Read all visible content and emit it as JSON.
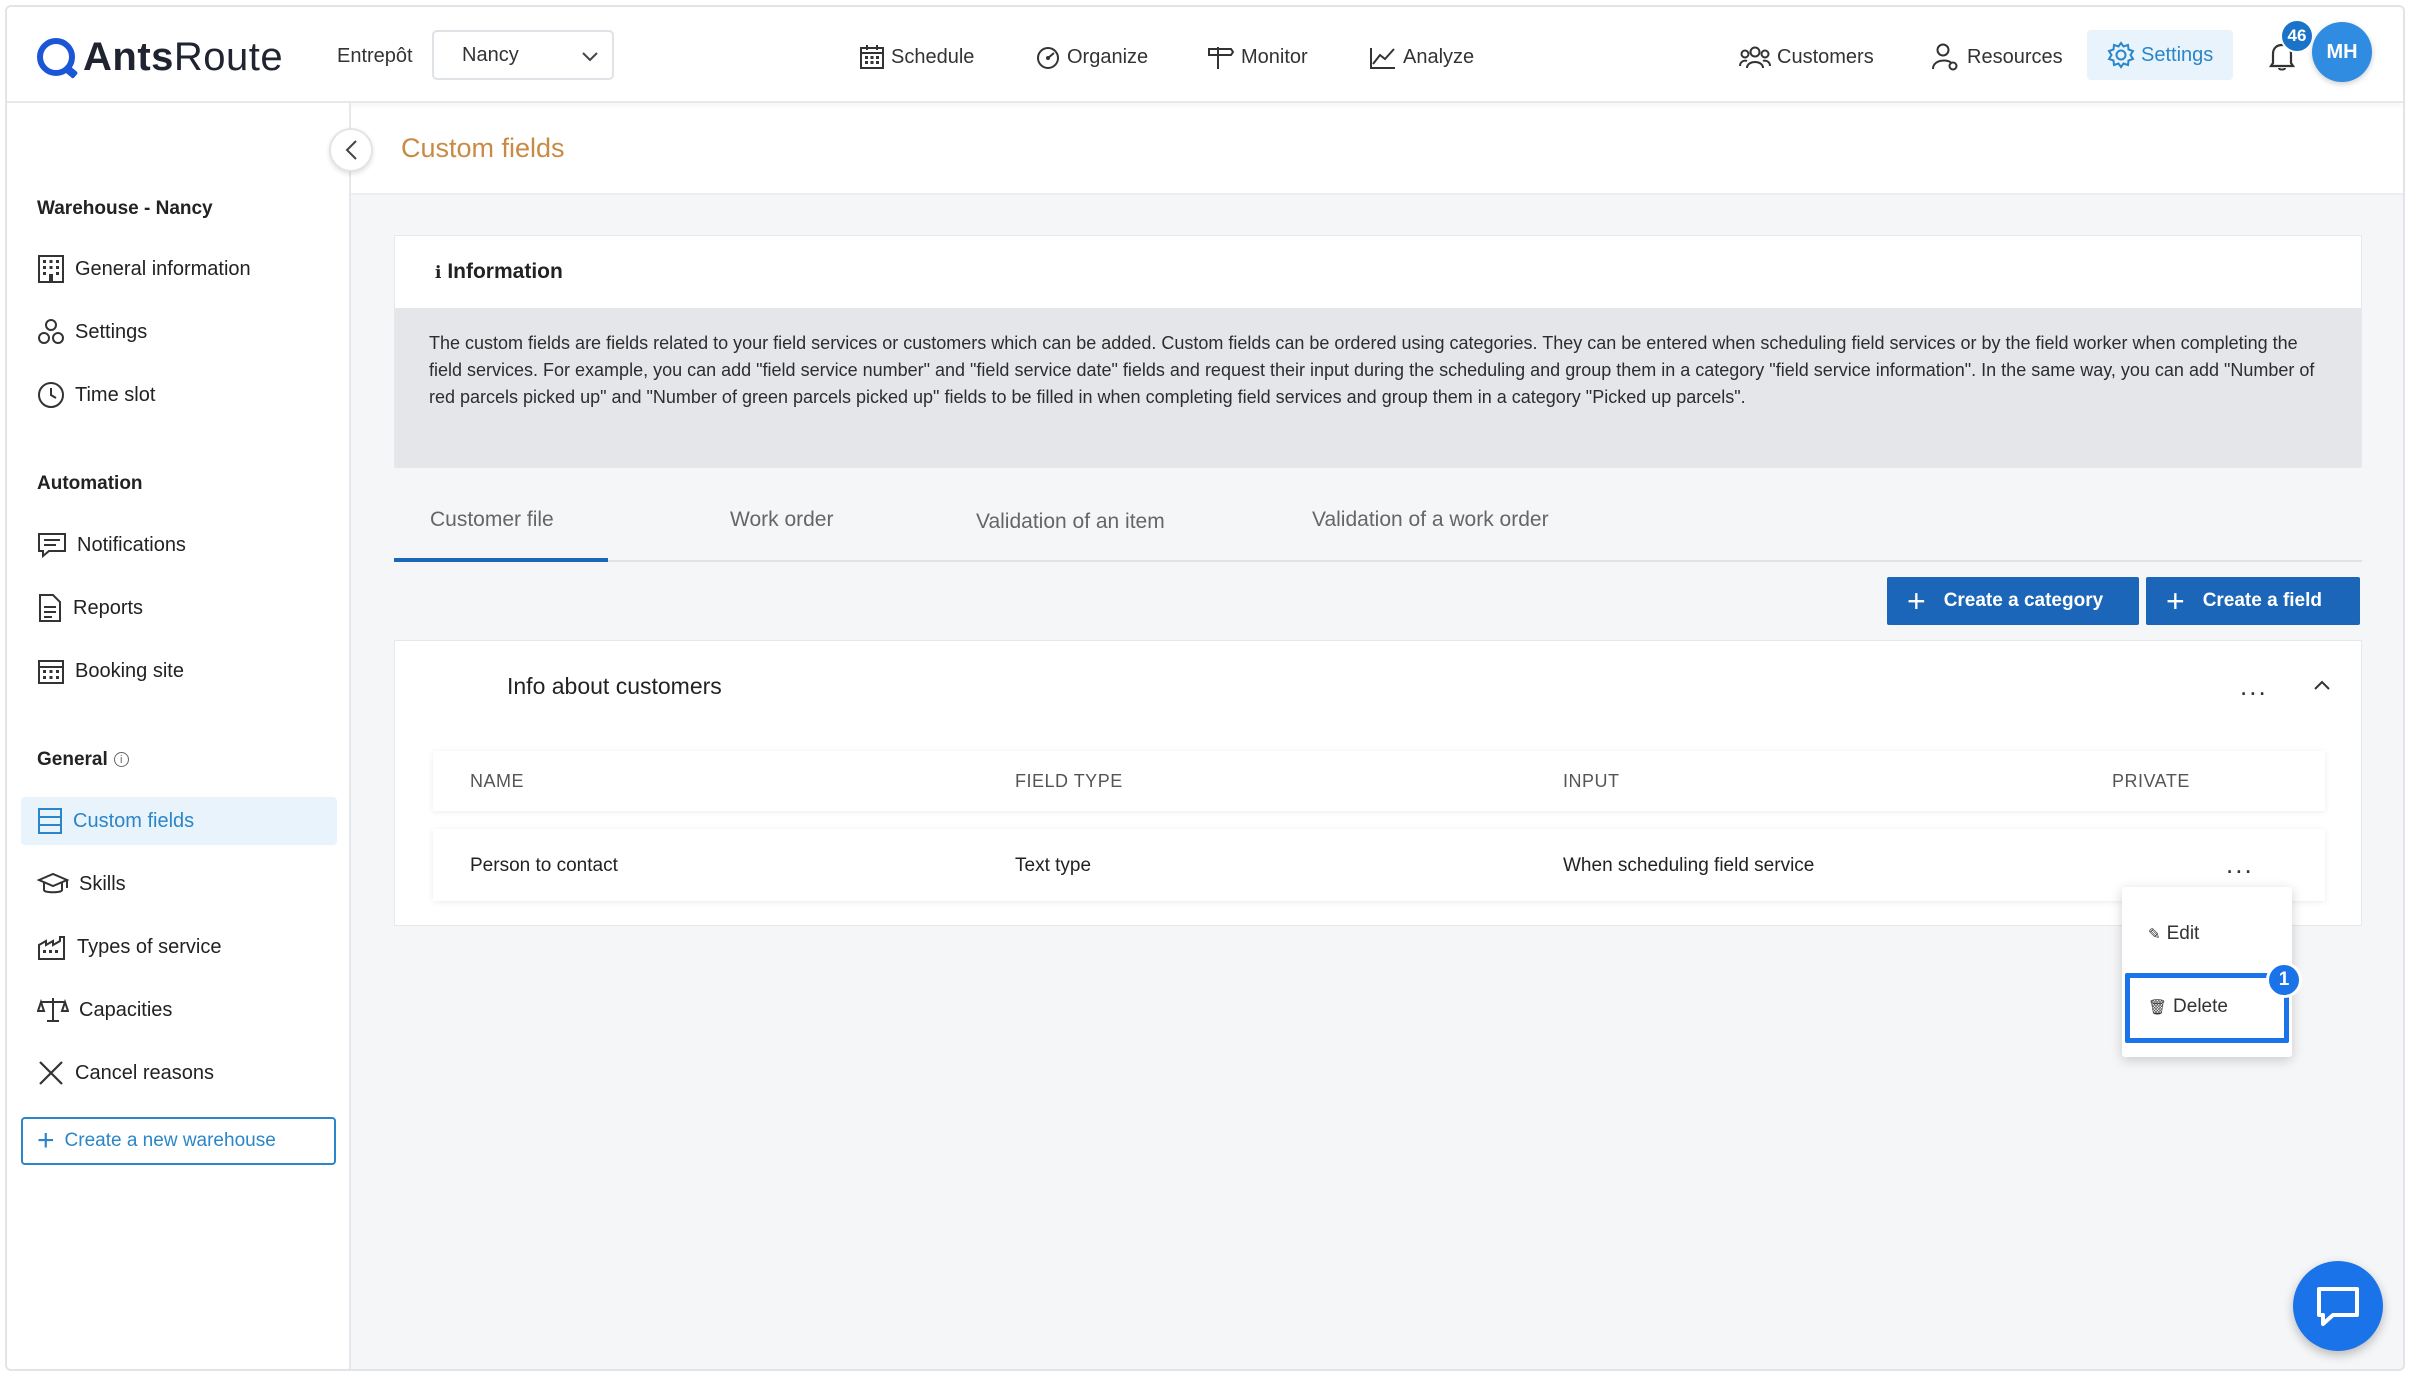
{
  "app": {
    "logo_text_a": "Ants",
    "logo_text_b": "Route"
  },
  "topbar": {
    "warehouse_label": "Entrepôt",
    "warehouse_value": "Nancy",
    "nav": {
      "schedule": "Schedule",
      "organize": "Organize",
      "monitor": "Monitor",
      "analyze": "Analyze",
      "customers": "Customers",
      "resources": "Resources",
      "settings": "Settings"
    },
    "notification_count": "46",
    "avatar_initials": "MH"
  },
  "sidebar": {
    "warehouse_heading": "Warehouse - Nancy",
    "warehouse_items": [
      "General information",
      "Settings",
      "Time slot"
    ],
    "automation_heading": "Automation",
    "automation_items": [
      "Notifications",
      "Reports",
      "Booking site"
    ],
    "general_heading": "General",
    "general_items": [
      "Custom fields",
      "Skills",
      "Types of service",
      "Capacities",
      "Cancel reasons"
    ],
    "create_warehouse_label": "Create a new warehouse"
  },
  "page": {
    "title": "Custom fields",
    "info": {
      "title": "Information",
      "body": "The custom fields are fields related to your field services or customers which can be added. Custom fields can be ordered using categories. They can be entered when scheduling field services or by the field worker when completing the field services. For example, you can add \"field service number\" and \"field service date\" fields and request their input during the scheduling and group them in a category \"field service information\". In the same way, you can add \"Number of red parcels picked up\" and \"Number of green parcels picked up\" fields to be filled in when completing field services and group them in a category \"Picked up parcels\"."
    },
    "tabs": [
      "Customer file",
      "Work order",
      "Validation of an item",
      "Validation of a work order"
    ],
    "buttons": {
      "create_category": "Create a category",
      "create_field": "Create a field"
    },
    "category": {
      "title": "Info about customers",
      "columns": [
        "NAME",
        "FIELD TYPE",
        "INPUT",
        "PRIVATE"
      ],
      "rows": [
        {
          "name": "Person to contact",
          "field_type": "Text type",
          "input": "When scheduling field service",
          "private": ""
        }
      ]
    },
    "menu": {
      "edit": "Edit",
      "delete": "Delete"
    },
    "step_badge": "1"
  },
  "colors": {
    "accent": "#1b66b8",
    "title_orange": "#c98a43",
    "active_blue": "#2a86c8",
    "highlight": "#1a73e8"
  }
}
